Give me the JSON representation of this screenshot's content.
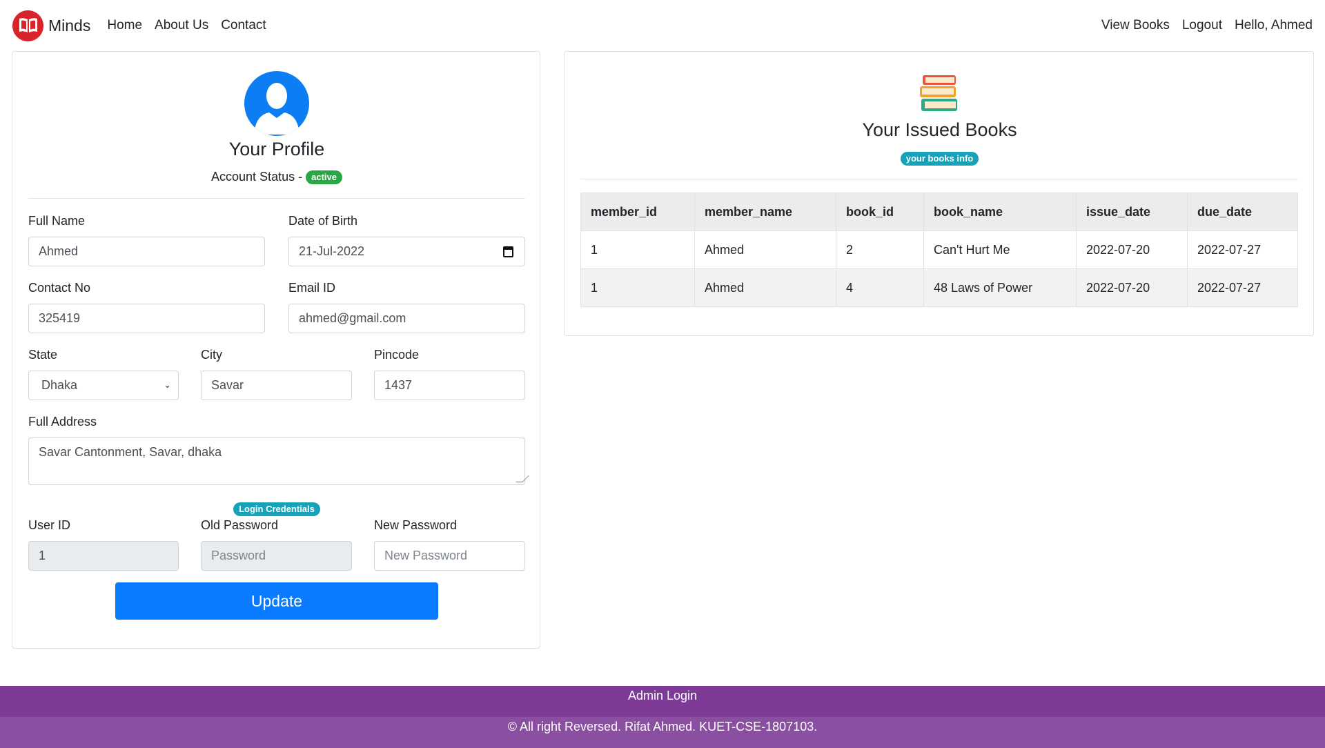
{
  "navbar": {
    "brand": "Minds",
    "links_left": [
      "Home",
      "About Us",
      "Contact"
    ],
    "links_right": [
      "View Books",
      "Logout",
      "Hello, Ahmed"
    ]
  },
  "profile": {
    "title": "Your Profile",
    "account_status_label": "Account Status -",
    "account_status": "active",
    "fields": {
      "full_name": {
        "label": "Full Name",
        "value": "Ahmed"
      },
      "dob": {
        "label": "Date of Birth",
        "value": "21-Jul-2022"
      },
      "contact": {
        "label": "Contact No",
        "value": "325419"
      },
      "email": {
        "label": "Email ID",
        "value": "ahmed@gmail.com"
      },
      "state": {
        "label": "State",
        "value": "Dhaka"
      },
      "city": {
        "label": "City",
        "value": "Savar"
      },
      "pincode": {
        "label": "Pincode",
        "value": "1437"
      },
      "address": {
        "label": "Full Address",
        "value": "Savar Cantonment, Savar, dhaka"
      }
    },
    "credentials_badge": "Login Credentials",
    "user_id": {
      "label": "User ID",
      "value": "1"
    },
    "old_password": {
      "label": "Old Password",
      "placeholder": "Password"
    },
    "new_password": {
      "label": "New Password",
      "placeholder": "New Password"
    },
    "update_button": "Update"
  },
  "books": {
    "title": "Your Issued Books",
    "badge": "your books info",
    "columns": [
      "member_id",
      "member_name",
      "book_id",
      "book_name",
      "issue_date",
      "due_date"
    ],
    "rows": [
      [
        "1",
        "Ahmed",
        "2",
        "Can't Hurt Me",
        "2022-07-20",
        "2022-07-27"
      ],
      [
        "1",
        "Ahmed",
        "4",
        "48 Laws of Power",
        "2022-07-20",
        "2022-07-27"
      ]
    ]
  },
  "footer": {
    "admin_login": "Admin Login",
    "copyright": "© All right Reversed. Rifat Ahmed. KUET-CSE-1807103."
  },
  "colors": {
    "primary": "#0a7bff",
    "success": "#28a745",
    "info": "#17a2b8",
    "footer_top": "#7d3a97",
    "footer_bottom": "#8a4fa1",
    "brand_logo": "#d8232a"
  }
}
